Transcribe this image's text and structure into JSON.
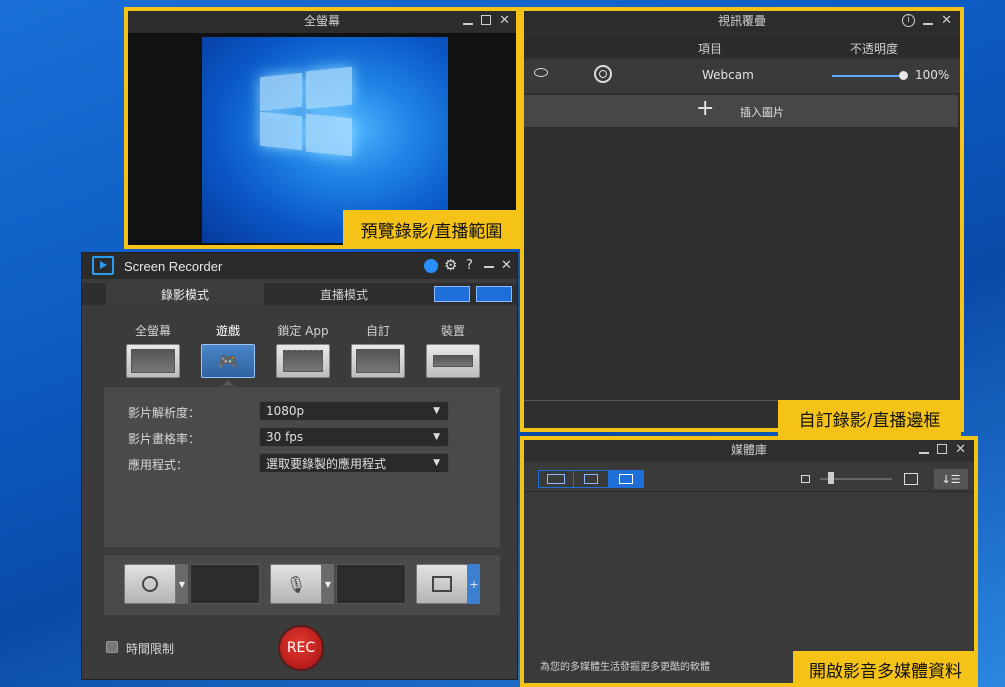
{
  "preview": {
    "title": "全螢幕",
    "callout": "預覽錄影/直播範圍"
  },
  "overlay": {
    "title": "視訊覆疊",
    "col_item": "項目",
    "col_opacity": "不透明度",
    "row_name": "Webcam",
    "row_opacity": "100%",
    "row_opacity_level": 1.0,
    "insert_label": "插入圖片",
    "callout": "自訂錄影/直播邊框"
  },
  "media": {
    "title": "媒體庫",
    "footer_link": "為您的多媒體生活發掘更多更酷的軟體",
    "callout": "開啟影音多媒體資料"
  },
  "recorder": {
    "title": "Screen Recorder",
    "tab_record": "錄影模式",
    "tab_live": "直播模式",
    "modes": [
      "全螢幕",
      "遊戲",
      "鎖定 App",
      "自訂",
      "裝置"
    ],
    "resolution_label": "影片解析度：",
    "resolution_value": "1080p",
    "framerate_label": "影片畫格率：",
    "framerate_value": "30 fps",
    "app_label": "應用程式：",
    "app_value": "選取要錄製的應用程式",
    "time_limit_label": "時間限制",
    "rec_label": "REC",
    "help_glyph": "?"
  },
  "colors": {
    "accent_yellow": "#f5c218",
    "accent_blue": "#1e6fd8",
    "rec_red": "#c9191c"
  }
}
